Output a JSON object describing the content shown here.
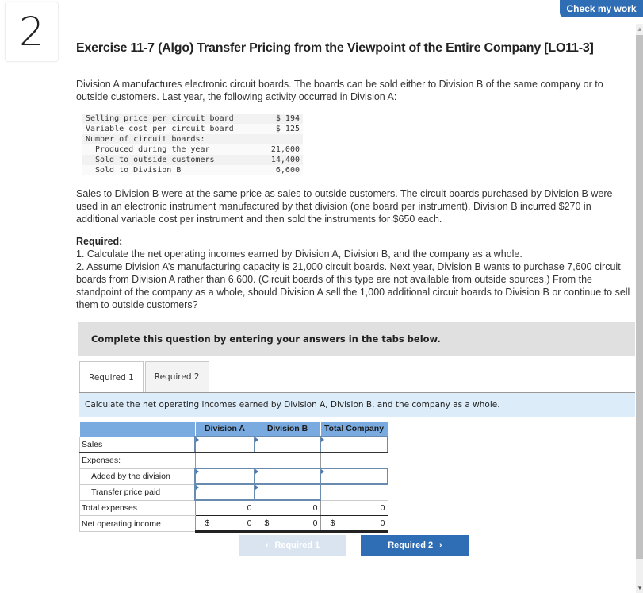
{
  "question_number": "2",
  "check_button": "Check my work",
  "title": "Exercise 11-7 (Algo) Transfer Pricing from the Viewpoint of the Entire Company [LO11-3]",
  "intro": "Division A manufactures electronic circuit boards. The boards can be sold either to Division B of the same company or to outside customers. Last year, the following activity occurred in Division A:",
  "facts": [
    {
      "label": "Selling price per circuit board",
      "value": "$ 194",
      "indent": false
    },
    {
      "label": "Variable cost per circuit board",
      "value": "$ 125",
      "indent": false
    },
    {
      "label": "Number of circuit boards:",
      "value": "",
      "indent": false
    },
    {
      "label": "Produced during the year",
      "value": "21,000",
      "indent": true
    },
    {
      "label": "Sold to outside customers",
      "value": "14,400",
      "indent": true
    },
    {
      "label": "Sold to Division B",
      "value": "6,600",
      "indent": true
    }
  ],
  "para2": "Sales to Division B were at the same price as sales to outside customers. The circuit boards purchased by Division B were used in an electronic instrument manufactured by that division (one board per instrument). Division B incurred $270 in additional variable cost per instrument and then sold the instruments for $650 each.",
  "required": {
    "heading": "Required:",
    "item1": "1. Calculate the net operating incomes earned by Division A, Division B, and the company as a whole.",
    "item2": "2. Assume Division A’s manufacturing capacity is 21,000 circuit boards. Next year, Division B wants to purchase 7,600 circuit boards from Division A rather than 6,600. (Circuit boards of this type are not available from outside sources.) From the standpoint of the company as a whole, should Division A sell the 1,000 additional circuit boards to Division B or continue to sell them to outside customers?"
  },
  "instructions": "Complete this question by entering your answers in the tabs below.",
  "tabs": [
    {
      "label": "Required 1",
      "active": true
    },
    {
      "label": "Required 2",
      "active": false
    }
  ],
  "task": "Calculate the net operating incomes earned by Division A, Division B, and the company as a whole.",
  "worksheet": {
    "columns": [
      "Division A",
      "Division B",
      "Total Company"
    ],
    "rows": {
      "sales": "Sales",
      "expenses": "Expenses:",
      "added": "Added by the division",
      "transfer": "Transfer price paid",
      "total": "Total expenses",
      "net": "Net operating income"
    },
    "total_values": [
      "0",
      "0",
      "0"
    ],
    "net_values": [
      "0",
      "0",
      "0"
    ],
    "currency": "$"
  },
  "nav": {
    "prev": "Required 1",
    "next": "Required 2",
    "prev_icon": "‹",
    "next_icon": "›"
  }
}
